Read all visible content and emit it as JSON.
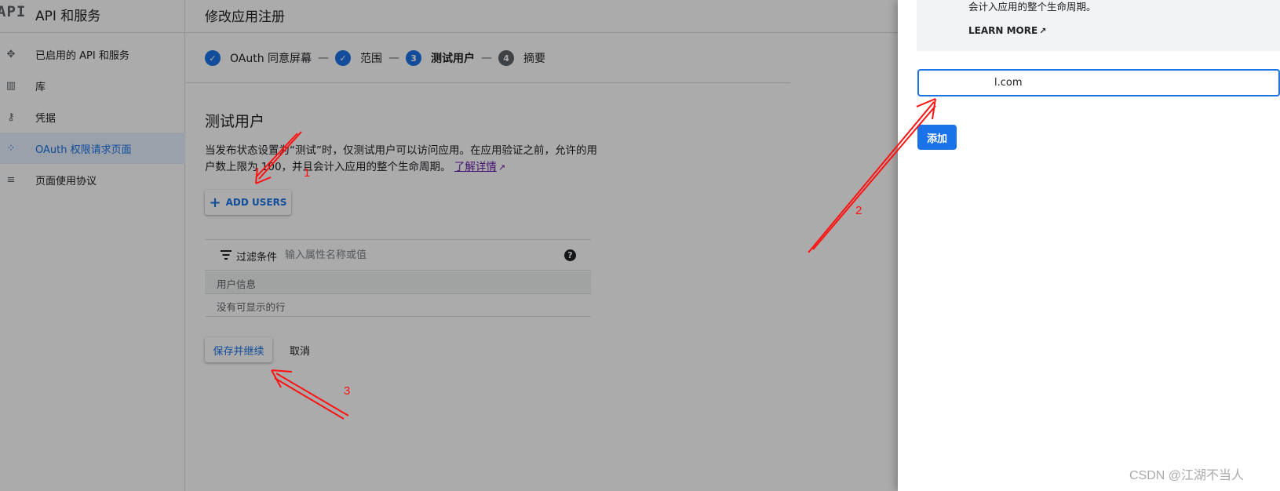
{
  "sidebar": {
    "logo": "API",
    "title": "API 和服务",
    "items": [
      {
        "label": "已启用的 API 和服务",
        "icon": "move-icon",
        "active": false
      },
      {
        "label": "库",
        "icon": "library-icon",
        "active": false
      },
      {
        "label": "凭据",
        "icon": "key-icon",
        "active": false
      },
      {
        "label": "OAuth 权限请求页面",
        "icon": "oauth-consent-icon",
        "active": true
      },
      {
        "label": "页面使用协议",
        "icon": "page-settings-icon",
        "active": false
      }
    ]
  },
  "main": {
    "title": "修改应用注册",
    "steps": [
      {
        "number": "",
        "label": "OAuth 同意屏幕",
        "state": "done"
      },
      {
        "number": "",
        "label": "范围",
        "state": "done"
      },
      {
        "number": "3",
        "label": "测试用户",
        "state": "current"
      },
      {
        "number": "4",
        "label": "摘要",
        "state": "todo"
      }
    ],
    "step_separator": "—",
    "section_title": "测试用户",
    "description": "当发布状态设置为“测试”时，仅测试用户可以访问应用。在应用验证之前，允许的用户数上限为 100，并且会计入应用的整个生命周期。",
    "learn_more_link": "了解详情",
    "add_users_label": "ADD USERS",
    "filter_label": "过滤条件",
    "filter_placeholder": "输入属性名称或值",
    "help_label": "?",
    "table_column": "用户信息",
    "table_empty": "没有可显示的行",
    "save_label": "保存并继续",
    "cancel_label": "取消"
  },
  "panel": {
    "info_text": "会计入应用的整个生命周期。",
    "learn_more": "LEARN MORE",
    "email_value": "l.com",
    "add_label": "添加"
  },
  "annotations": {
    "labels": [
      "1",
      "2",
      "3"
    ],
    "color": "#ff1111"
  },
  "watermark": "CSDN @江湖不当人",
  "colors": {
    "accent": "#1a73e8",
    "link_visited": "#681da8",
    "scrim": "rgba(0,0,0,0.33)"
  }
}
